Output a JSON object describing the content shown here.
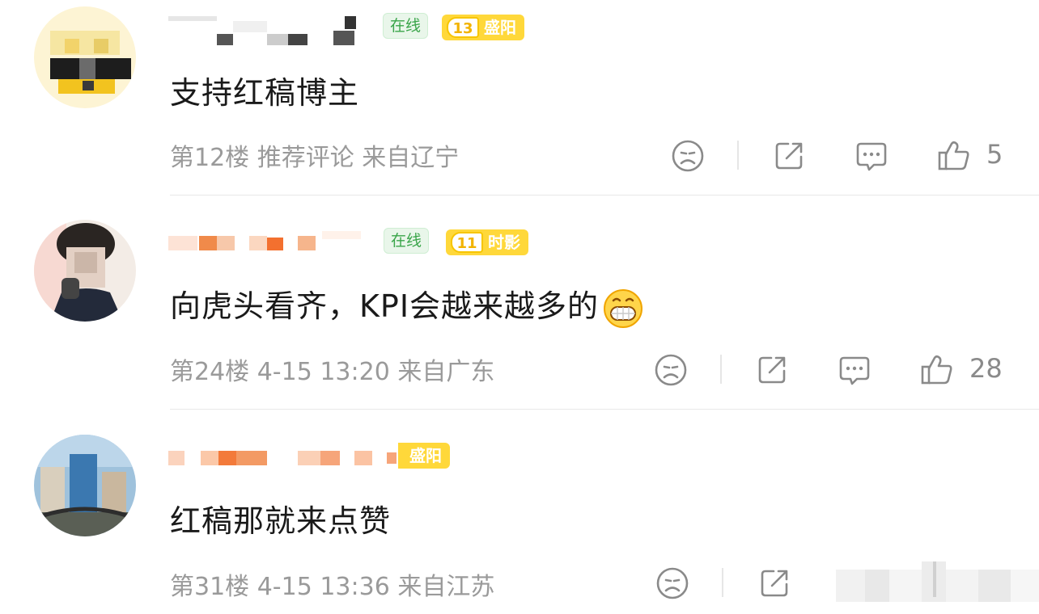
{
  "comments": [
    {
      "text": "支持红稿博主",
      "online_badge": "在线",
      "level": "13",
      "city": "盛阳",
      "meta": "第12楼 推荐评论 来自辽宁",
      "likes": "5"
    },
    {
      "text": "向虎头看齐，KPI会越来越多的",
      "online_badge": "在线",
      "level": "11",
      "city": "时影",
      "meta": "第24楼 4-15 13:20 来自广东",
      "likes": "28"
    },
    {
      "text": "红稿那就来点赞",
      "city": "盛阳",
      "meta": "第31楼 4-15 13:36 来自江苏",
      "likes": ""
    }
  ],
  "icons": [
    "sad-face-icon",
    "share-icon",
    "comment-icon",
    "thumbs-up-icon",
    "grin-emoji-icon"
  ],
  "colors": {
    "online_green": "#3aa54a",
    "level_yellow": "#ffd83a",
    "meta_gray": "#9a9a9a"
  }
}
